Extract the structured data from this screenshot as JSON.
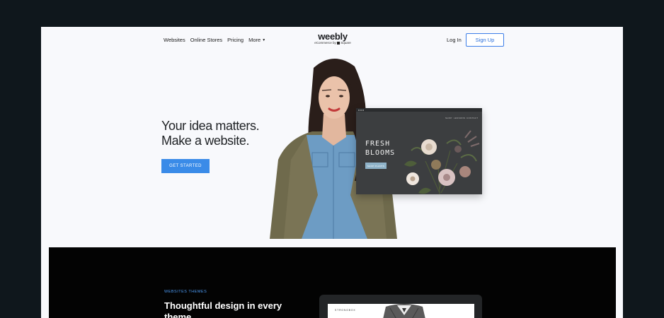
{
  "header": {
    "nav": [
      "Websites",
      "Online Stores",
      "Pricing",
      "More"
    ],
    "logo": "weebly",
    "logo_sub_prefix": "eCommerce by",
    "logo_sub_brand": "Square",
    "login": "Log In",
    "signup": "Sign Up"
  },
  "hero": {
    "title_line1": "Your idea matters.",
    "title_line2": "Make a website.",
    "cta": "GET STARTED"
  },
  "mockup": {
    "nav": [
      "SHOP",
      "LESSONS",
      "CONTACT"
    ],
    "title_line1": "FRESH",
    "title_line2": "BLOOMS",
    "button": "SHOP PLANTS"
  },
  "themes": {
    "eyebrow": "WEBSITES THEMES",
    "title": "Thoughtful design in every theme.",
    "device_label": "STRONGBOX"
  },
  "colors": {
    "accent": "#3a8be8",
    "page_bg": "#0f171c",
    "frame_bg": "#f8f9fc",
    "band_bg": "#030303"
  }
}
